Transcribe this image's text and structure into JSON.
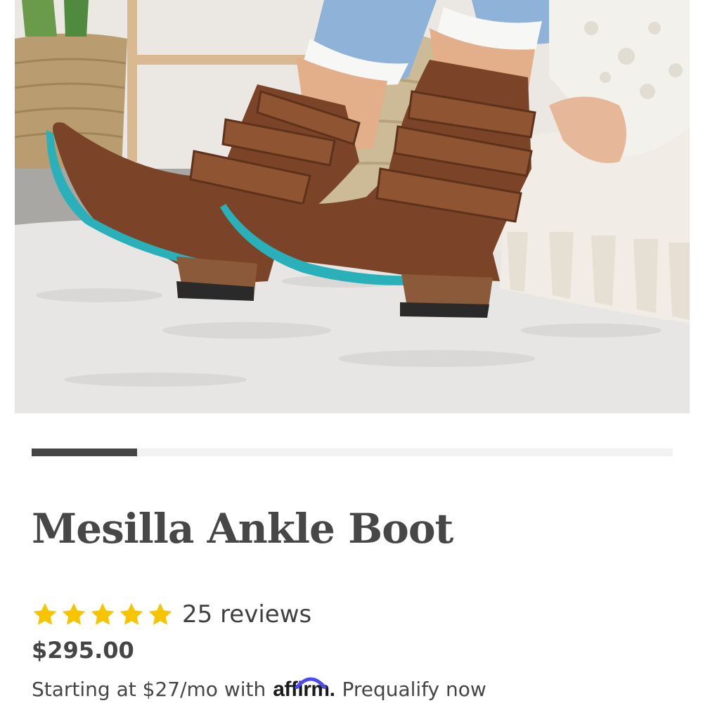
{
  "hero_image": {
    "alt": "Brown leather ankle boots with woven straps and turquoise soles on a white shag rug"
  },
  "carousel": {
    "progress": 0.165
  },
  "product": {
    "title": "Mesilla Ankle Boot",
    "rating": 5,
    "reviews_label": "25 reviews",
    "price": "$295.00",
    "financing_prefix": "Starting at $27/mo with",
    "financing_brand": "affirm",
    "financing_brand_suffix": ".",
    "prequalify_label": "Prequalify now"
  },
  "colors": {
    "star": "#f7c500",
    "title": "#474747",
    "affirm_arc": "#4a4af4",
    "progress_fill": "#454545",
    "progress_track": "#f2f2f2",
    "boot_sole": "#2ab0b8"
  },
  "icons": {
    "star": "star-icon",
    "affirm": "affirm-logo-icon"
  }
}
